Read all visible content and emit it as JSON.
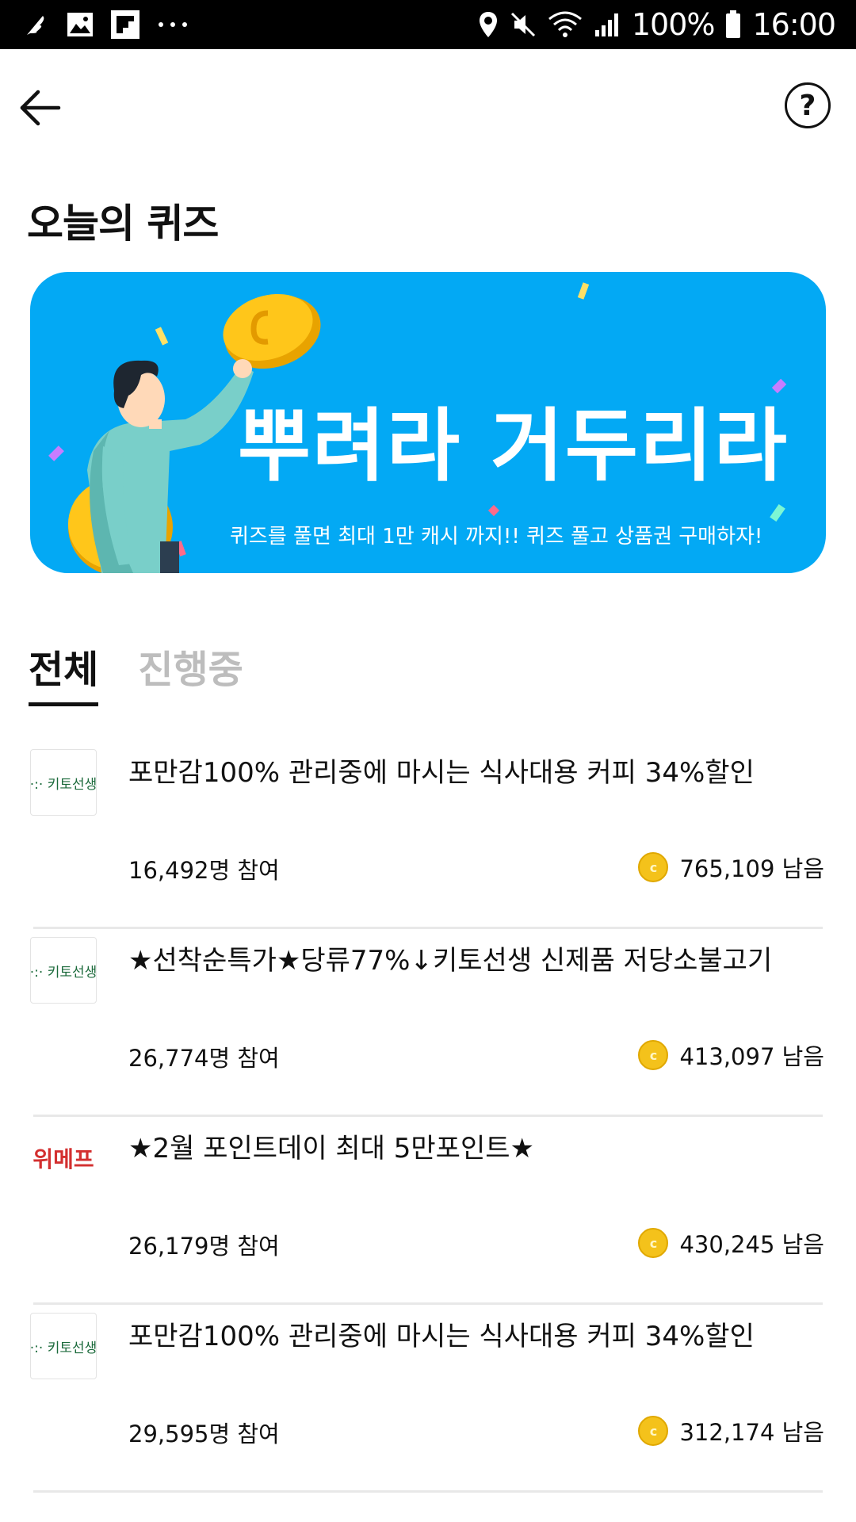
{
  "status_bar": {
    "battery": "100%",
    "time": "16:00"
  },
  "header": {
    "help_label": "?"
  },
  "page_title": "오늘의 퀴즈",
  "banner": {
    "headline": "뿌려라 거두리라",
    "subtitle": "퀴즈를 풀면 최대 1만 캐시 까지!!  퀴즈 풀고 상품권 구매하자!",
    "background_color": "#03a9f4"
  },
  "tabs": [
    {
      "label": "전체",
      "active": true
    },
    {
      "label": "진행중",
      "active": false
    }
  ],
  "quizzes": [
    {
      "brand": "·:· 키토선생",
      "title": "포만감100% 관리중에 마시는 식사대용 커피 34%할인",
      "participants": "16,492명 참여",
      "remaining": "765,109 남음"
    },
    {
      "brand": "·:· 키토선생",
      "title": "★선착순특가★당류77%↓키토선생 신제품 저당소불고기",
      "participants": "26,774명 참여",
      "remaining": "413,097 남음"
    },
    {
      "brand": "위메프",
      "title": "★2월 포인트데이 최대 5만포인트★",
      "participants": "26,179명 참여",
      "remaining": "430,245 남음"
    },
    {
      "brand": "·:· 키토선생",
      "title": "포만감100% 관리중에 마시는 식사대용 커피 34%할인",
      "participants": "29,595명 참여",
      "remaining": "312,174 남음"
    }
  ]
}
